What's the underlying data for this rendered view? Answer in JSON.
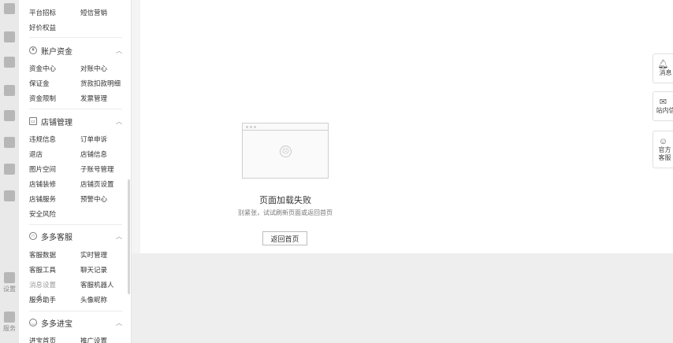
{
  "top_partial": {
    "row1_left": "平台招标",
    "row1_right": "短信营销",
    "row2_left": "好价权益"
  },
  "groups": [
    {
      "title": "账户资金",
      "icon": "yen-icon",
      "rows": [
        [
          "资金中心",
          "对账中心"
        ],
        [
          "保证金",
          "货款扣款明细"
        ],
        [
          "资金限制",
          "发票管理"
        ]
      ]
    },
    {
      "title": "店铺管理",
      "icon": "store-icon",
      "rows": [
        [
          "违规信息",
          "订单申诉"
        ],
        [
          "退店",
          "店铺信息"
        ],
        [
          "图片空间",
          "子账号管理"
        ],
        [
          "店铺装修",
          "店铺页设置"
        ],
        [
          "店铺服务",
          "预警中心"
        ],
        [
          "安全风险",
          ""
        ]
      ]
    },
    {
      "title": "多多客服",
      "icon": "headset-icon",
      "rows": [
        [
          "客服数据",
          "实时管理"
        ],
        [
          "客服工具",
          "聊天记录"
        ],
        [
          "消息设置",
          "客服机器人"
        ],
        [
          "服务助手",
          "头像昵称"
        ]
      ]
    },
    {
      "title": "多多进宝",
      "icon": "promo-icon",
      "rows": [
        [
          "进宝首页",
          "推广设置"
        ]
      ]
    }
  ],
  "error": {
    "title": "页面加载失败",
    "subtitle": "别紧张，试试刷新页面或返回首页",
    "button": "返回首页"
  },
  "float_buttons": [
    {
      "label": "消息",
      "icon": "bell-icon"
    },
    {
      "label": "站内信",
      "icon": "mail-icon"
    },
    {
      "label": "官方客服",
      "icon": "service-icon"
    }
  ],
  "rail_labels": [
    "设置",
    "服务"
  ]
}
